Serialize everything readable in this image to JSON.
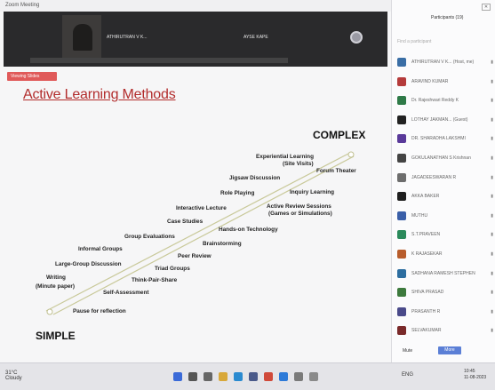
{
  "window": {
    "title": "Zoom Meeting"
  },
  "video_strip": {
    "names": [
      "ATHIRUTRAN V K...",
      "AYSE KAPE"
    ]
  },
  "view_badge": "Viewing Slides",
  "slide": {
    "title": "Active Learning Methods",
    "complex_label": "COMPLEX",
    "simple_label": "SIMPLE",
    "upper_items": [
      "Experiential Learning",
      "(Site Visits)",
      "Jigsaw Discussion",
      "Role Playing",
      "Interactive Lecture",
      "Case Studies",
      "Group Evaluations",
      "Informal Groups",
      "Large-Group Discussion",
      "Writing",
      "(Minute paper)"
    ],
    "lower_items": [
      "Forum Theater",
      "Inquiry Learning",
      "Active Review Sessions",
      "(Games or Simulations)",
      "Hands-on Technology",
      "Brainstorming",
      "Peer Review",
      "Triad Groups",
      "Think-Pair-Share",
      "Self-Assessment",
      "Pause for reflection"
    ]
  },
  "panel": {
    "title": "Participants (19)",
    "close": "✕",
    "search_placeholder": "Find a participant",
    "participants": [
      {
        "name": "ATHIRUTRAN V K... (Host, me)",
        "color": "#3a6ea5"
      },
      {
        "name": "ARAVIND KUMAR",
        "color": "#b53b3b"
      },
      {
        "name": "Dr. Rajeshwari Reddy K",
        "color": "#2f7a48"
      },
      {
        "name": "LOTHAY JAKMAN... (Guest)",
        "color": "#222222"
      },
      {
        "name": "DR. SHARADHA LAKSHMI",
        "color": "#5a3a9a"
      },
      {
        "name": "GOKULANATHAN S Krishnan",
        "color": "#444444"
      },
      {
        "name": "JAGADEESWARAN R",
        "color": "#6d6d6d"
      },
      {
        "name": "AKKA BAKER",
        "color": "#1f1f1f"
      },
      {
        "name": "MUTHU",
        "color": "#3a5fa8"
      },
      {
        "name": "S.T.PRAVEEN",
        "color": "#2b8a5b"
      },
      {
        "name": "K RAJASEKAR",
        "color": "#b85d2c"
      },
      {
        "name": "SADHANA RAMESH STEPHEN",
        "color": "#2d6ea0"
      },
      {
        "name": "SHIVA PRASAD",
        "color": "#3d7a3d"
      },
      {
        "name": "PRASANTH R",
        "color": "#4a4a8a"
      },
      {
        "name": "SELVAKUMAR",
        "color": "#7a2a2a"
      }
    ],
    "mute_all": "Mute",
    "more": "More"
  },
  "taskbar": {
    "weather": "31°C",
    "weather_sub": "Cloudy",
    "tray": "ENG",
    "time": "10:45",
    "date": "11-08-2023"
  }
}
